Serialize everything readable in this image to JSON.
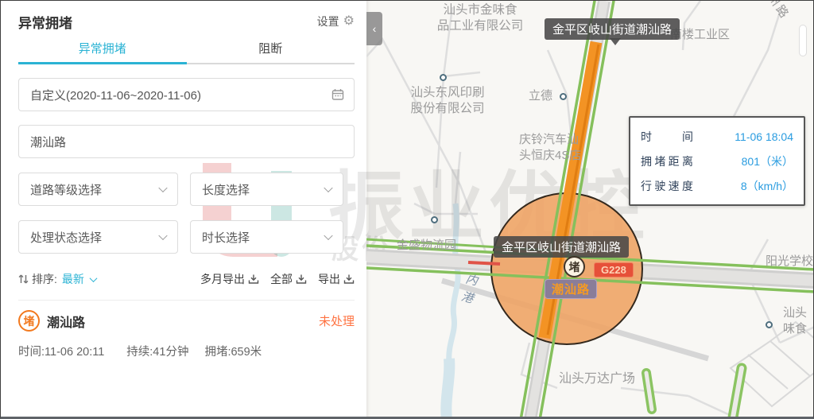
{
  "panel": {
    "title": "异常拥堵",
    "settings_label": "设置",
    "tabs": [
      {
        "label": "异常拥堵"
      },
      {
        "label": "阻断"
      }
    ],
    "date_filter_value": "自定义(2020-11-06~2020-11-06)",
    "search_value": "潮汕路",
    "selects": [
      "道路等级选择",
      "长度选择",
      "处理状态选择",
      "时长选择"
    ],
    "sort": {
      "label": "排序:",
      "value": "最新"
    },
    "export": {
      "multi": "多月导出",
      "all": "全部",
      "single": "导出"
    },
    "list": {
      "items": [
        {
          "badge": "堵",
          "road": "潮汕路",
          "status": "未处理",
          "time": "时间:11-06 20:11",
          "duration": "持续:41分钟",
          "distance": "拥堵:659米"
        }
      ]
    }
  },
  "map": {
    "collapse_glyph": "‹",
    "tooltip_top": "金平区岐山街道潮汕路",
    "tooltip_center": "金平区岐山街道潮汕路",
    "jam_badge": "堵",
    "route_badge": "G228",
    "road_badge": "潮汕路",
    "info_box": {
      "rows": [
        {
          "label": "时间",
          "value": "11-06 18:04"
        },
        {
          "label": "拥堵距离",
          "value": "801（米）"
        },
        {
          "label": "行驶速度",
          "value": "8（km/h）"
        }
      ]
    },
    "labels": {
      "jinwei": "汕头市金味食\n品工业有限公司",
      "nanlou": "南楼工业区",
      "road_ne": "州路",
      "dongfeng": "汕头东风印刷\n股份有限公司",
      "lide": "立德",
      "qingling": "庆铃汽车汕\n头恒庆4S店",
      "jinsheng": "金盛物流园",
      "neigang": "内港",
      "yangguang": "阳光学校",
      "shantou_wei": "汕头\n味食",
      "wanda": "汕头万达广场"
    }
  },
  "watermark": {
    "text": "振业优控",
    "sub": "股份"
  },
  "colors": {
    "accent_cyan": "#2bb3d4",
    "congestion_orange": "#f39324",
    "status_red": "#ff7342",
    "route_badge_red": "#e65039",
    "traffic_green": "#85c05c",
    "info_value_blue": "#2a9ce0"
  }
}
